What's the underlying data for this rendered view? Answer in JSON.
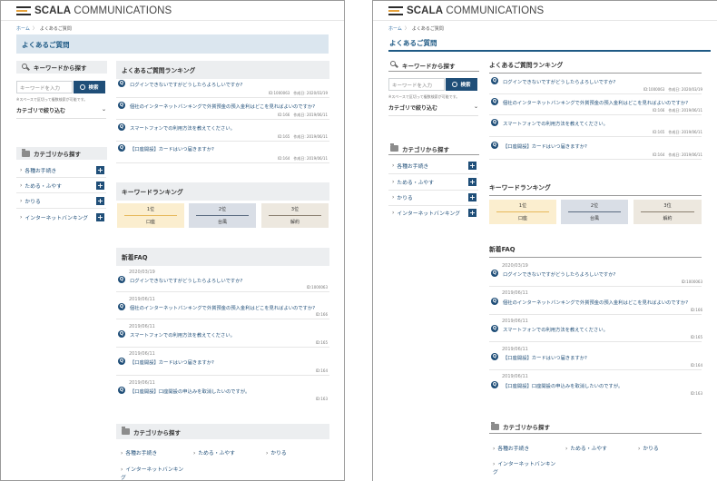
{
  "logo": {
    "brand_bold": "SCALA",
    "brand_rest": " COMMUNICATIONS"
  },
  "breadcrumb": {
    "home": "ホーム",
    "separator": "〉",
    "current": "よくあるご質問"
  },
  "page_title": "よくあるご質問",
  "keyword_search": {
    "title": "キーワードから探す",
    "placeholder": "キーワードを入力",
    "button": "検索",
    "note": "※スペースで区切って複数検索が可能です。"
  },
  "narrow_down": "カテゴリで絞り込む",
  "category_box": {
    "title": "カテゴリから探す",
    "items": [
      "各種お手続き",
      "ためる・ふやす",
      "かりる",
      "インターネットバンキング"
    ]
  },
  "faq_ranking": {
    "title": "よくあるご質問ランキング",
    "items": [
      {
        "q": "ログインできないですがどうしたらよろしいですか?",
        "meta": "ID:1000063　作成日: 2020/03/19"
      },
      {
        "q": "個社のインターネットバンキングで外貨預金の預入金利はどこを見ればよいのですか?",
        "meta": "ID:166　作成日: 2019/06/11"
      },
      {
        "q": "スマートフォンでの利用方法を教えてください。",
        "meta": "ID:165　作成日: 2019/06/11"
      },
      {
        "q": "【口座開設】カードはいつ届きますか?",
        "meta": "ID:164　作成日: 2019/06/11"
      }
    ]
  },
  "keyword_ranking": {
    "title": "キーワードランキング",
    "items": [
      {
        "rank": "1位",
        "word": "口座"
      },
      {
        "rank": "2位",
        "word": "台風"
      },
      {
        "rank": "3位",
        "word": "解約"
      }
    ],
    "colors": [
      "#fbeecf",
      "#d9dee6",
      "#ede8df"
    ],
    "rule_colors": [
      "#e6b85c",
      "#5a6b80",
      "#8a7f70"
    ]
  },
  "new_faq": {
    "title": "新着FAQ",
    "items": [
      {
        "date": "2020/03/19",
        "q": "ログインできないですがどうしたらよろしいですか?",
        "id": "ID:1000063"
      },
      {
        "date": "2019/06/11",
        "q": "個社のインターネットバンキングで外貨預金の預入金利はどこを見ればよいのですか?",
        "id": "ID:166"
      },
      {
        "date": "2019/06/11",
        "q": "スマートフォンでの利用方法を教えてください。",
        "id": "ID:165"
      },
      {
        "date": "2019/06/11",
        "q": "【口座開設】カードはいつ届きますか?",
        "id": "ID:164"
      },
      {
        "date": "2019/06/11",
        "q": "【口座開設】口座開設の申込みを取消したいのですが。",
        "id": "ID:163"
      }
    ]
  },
  "bottom_category": {
    "title": "カテゴリから探す",
    "items": [
      "各種お手続き",
      "ためる・ふやす",
      "かりる",
      "インターネットバンキング"
    ]
  },
  "icons": {
    "plus": "+",
    "q": "Q",
    "arrow": "›",
    "chevron": "⌄"
  },
  "accent_color": "#1f4e78"
}
